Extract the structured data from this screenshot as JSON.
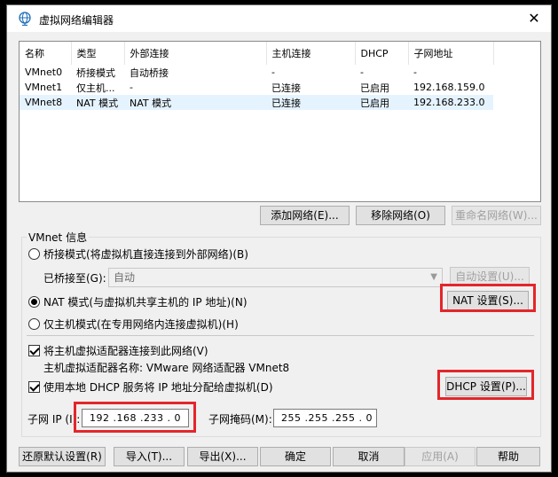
{
  "window": {
    "title": "虚拟网络编辑器",
    "close_glyph": "✕"
  },
  "list": {
    "columns": [
      "名称",
      "类型",
      "外部连接",
      "主机连接",
      "DHCP",
      "子网地址"
    ],
    "rows": [
      [
        "VMnet0",
        "桥接模式",
        "自动桥接",
        "-",
        "-",
        "-"
      ],
      [
        "VMnet1",
        "仅主机...",
        "-",
        "已连接",
        "已启用",
        "192.168.159.0"
      ],
      [
        "VMnet8",
        "NAT 模式",
        "NAT 模式",
        "已连接",
        "已启用",
        "192.168.233.0"
      ]
    ]
  },
  "list_buttons": {
    "add": "添加网络(E)...",
    "remove": "移除网络(O)",
    "rename": "重命名网络(W)..."
  },
  "vmnet_info": {
    "title": "VMnet 信息",
    "bridged_label": "桥接模式(将虚拟机直接连接到外部网络)(B)",
    "bridged_to_label": "已桥接至(G):",
    "bridged_to_value": "自动",
    "auto_settings": "自动设置(U)...",
    "nat_label": "NAT 模式(与虚拟机共享主机的 IP 地址)(N)",
    "nat_settings": "NAT 设置(S)...",
    "hostonly_label": "仅主机模式(在专用网络内连接虚拟机)(H)",
    "connect_adapter_label": "将主机虚拟适配器连接到此网络(V)",
    "adapter_name_label": "主机虚拟适配器名称: VMware 网络适配器 VMnet8",
    "dhcp_label": "使用本地 DHCP 服务将 IP 地址分配给虚拟机(D)",
    "dhcp_settings": "DHCP 设置(P)...",
    "subnet_ip_label": "子网 IP (I):",
    "subnet_ip_value": "192 .168 .233 . 0",
    "subnet_mask_label": "子网掩码(M):",
    "subnet_mask_value": "255 .255 .255 . 0",
    "selected_mode": "nat",
    "connect_adapter_checked": true,
    "dhcp_checked": true
  },
  "footer": {
    "restore": "还原默认设置(R)",
    "import": "导入(T)...",
    "export": "导出(X)...",
    "ok": "确定",
    "cancel": "取消",
    "apply": "应用(A)",
    "help": "帮助"
  },
  "colors": {
    "highlight_box": "#e3262b",
    "selected_row": "#e5f3ff",
    "window_bg": "#f0f0f0"
  }
}
